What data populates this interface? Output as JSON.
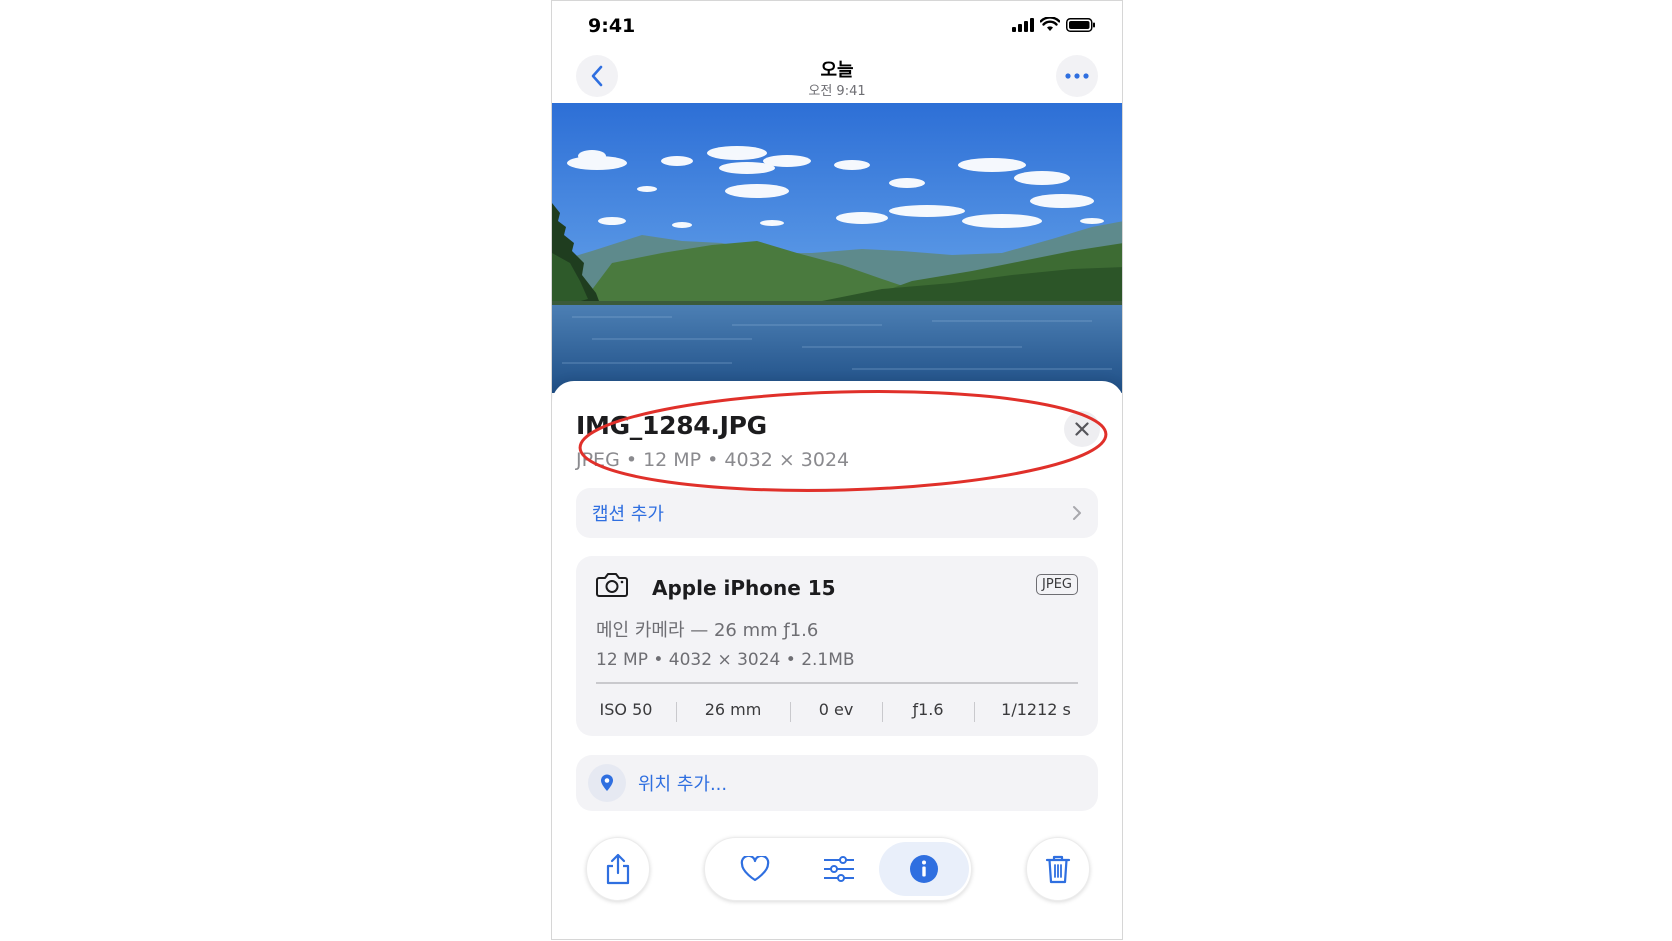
{
  "status_bar": {
    "time": "9:41"
  },
  "nav": {
    "title": "오늘",
    "subtitle": "오전 9:41"
  },
  "file": {
    "name": "IMG_1284.JPG",
    "meta": "JPEG • 12 MP • 4032 × 3024"
  },
  "caption": {
    "label": "캡션 추가"
  },
  "camera": {
    "model": "Apple iPhone 15",
    "format_badge": "JPEG",
    "lens": "메인 카메라 — 26 mm ƒ1.6",
    "specs": "12 MP • 4032 × 3024 • 2.1MB",
    "exif": [
      {
        "value": "ISO 50"
      },
      {
        "value": "26 mm"
      },
      {
        "value": "0 ev"
      },
      {
        "value": "ƒ1.6"
      },
      {
        "value": "1/1212 s"
      }
    ]
  },
  "location": {
    "label": "위치 추가..."
  },
  "colors": {
    "accent": "#2f6fe0",
    "annotation": "#e0302a",
    "card_bg": "#f3f3f6"
  }
}
